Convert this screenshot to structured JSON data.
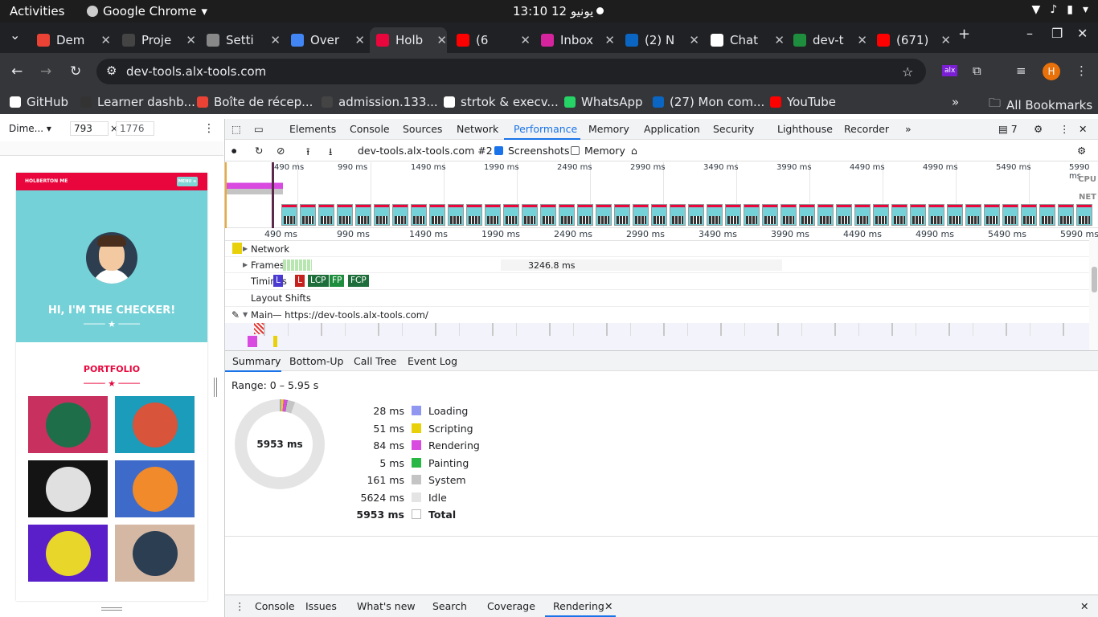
{
  "system": {
    "activities": "Activities",
    "app": "Google Chrome",
    "clock": "يونيو 12  13:10"
  },
  "tabs": [
    {
      "title": "Dem",
      "color": "#ea4335"
    },
    {
      "title": "Proje",
      "color": "#444"
    },
    {
      "title": "Setti",
      "color": "#888"
    },
    {
      "title": "Over",
      "color": "#4285f4"
    },
    {
      "title": "Holb",
      "color": "#e8063c"
    },
    {
      "title": "(6",
      "color": "#ff0000"
    },
    {
      "title": "Inbox",
      "color": "#d6249f"
    },
    {
      "title": "(2) N",
      "color": "#0a66c2"
    },
    {
      "title": "Chat",
      "color": "#ffffff"
    },
    {
      "title": "dev-t",
      "color": "#1e8e3e"
    },
    {
      "title": "(671)",
      "color": "#ff0000"
    }
  ],
  "url": "dev-tools.alx-tools.com",
  "bookmarks": [
    {
      "label": "GitHub",
      "color": "#ffffff"
    },
    {
      "label": "Learner dashb...",
      "color": "#333"
    },
    {
      "label": "Boîte de récep...",
      "color": "#ea4335"
    },
    {
      "label": "admission.133...",
      "color": "#444"
    },
    {
      "label": "strtok & execv...",
      "color": "#ffffff"
    },
    {
      "label": "WhatsApp",
      "color": "#25d366"
    },
    {
      "label": "(27) Mon com...",
      "color": "#0a66c2"
    },
    {
      "label": "YouTube",
      "color": "#ff0000"
    }
  ],
  "all_bookmarks": "All Bookmarks",
  "device": {
    "name": "Dime...",
    "width": "793",
    "height": "1776"
  },
  "site": {
    "brand": "HOLBERTON ME",
    "menu": "MENU ≡",
    "hero_title": "HI, I'M THE CHECKER!",
    "portfolio": "PORTFOLIO"
  },
  "devtools_tabs": [
    "Elements",
    "Console",
    "Sources",
    "Network",
    "Performance",
    "Memory",
    "Application",
    "Security",
    "Lighthouse",
    "Recorder"
  ],
  "active_tab": "Performance",
  "issues_count": "7",
  "recording": "dev-tools.alx-tools.com #2",
  "screenshots_label": "Screenshots",
  "memory_label": "Memory",
  "overview_ticks": [
    "490 ms",
    "990 ms",
    "1490 ms",
    "1990 ms",
    "2490 ms",
    "2990 ms",
    "3490 ms",
    "3990 ms",
    "4490 ms",
    "4990 ms",
    "5490 ms",
    "5990 ms"
  ],
  "overview_labels": {
    "cpu": "CPU",
    "net": "NET"
  },
  "tracks": {
    "network": "Network",
    "frames": "Frames",
    "frames_dur": "3246.8 ms",
    "timings": "Timings",
    "layout": "Layout Shifts",
    "main": "Main",
    "main_url": "— https://dev-tools.alx-tools.com/"
  },
  "timing_marks": [
    {
      "label": "L",
      "color": "#4a3ad1"
    },
    {
      "label": "L",
      "color": "#c5221f"
    },
    {
      "label": "LCP",
      "color": "#1e6e3b"
    },
    {
      "label": "FP",
      "color": "#1e8e3e"
    },
    {
      "label": "FCP",
      "color": "#1e6e3b"
    }
  ],
  "bottom_tabs": [
    "Summary",
    "Bottom-Up",
    "Call Tree",
    "Event Log"
  ],
  "summary": {
    "range": "Range: 0 – 5.95 s",
    "total_center": "5953 ms",
    "rows": [
      {
        "ms": "28 ms",
        "name": "Loading",
        "color": "#8f97f1"
      },
      {
        "ms": "51 ms",
        "name": "Scripting",
        "color": "#e8d10a"
      },
      {
        "ms": "84 ms",
        "name": "Rendering",
        "color": "#d84ae0"
      },
      {
        "ms": "5 ms",
        "name": "Painting",
        "color": "#28b744"
      },
      {
        "ms": "161 ms",
        "name": "System",
        "color": "#c4c4c4"
      },
      {
        "ms": "5624 ms",
        "name": "Idle",
        "color": "#e4e4e4"
      },
      {
        "ms": "5953 ms",
        "name": "Total",
        "color": "#ffffff"
      }
    ]
  },
  "drawer_tabs": [
    "Console",
    "Issues",
    "What's new",
    "Search",
    "Coverage",
    "Rendering"
  ]
}
